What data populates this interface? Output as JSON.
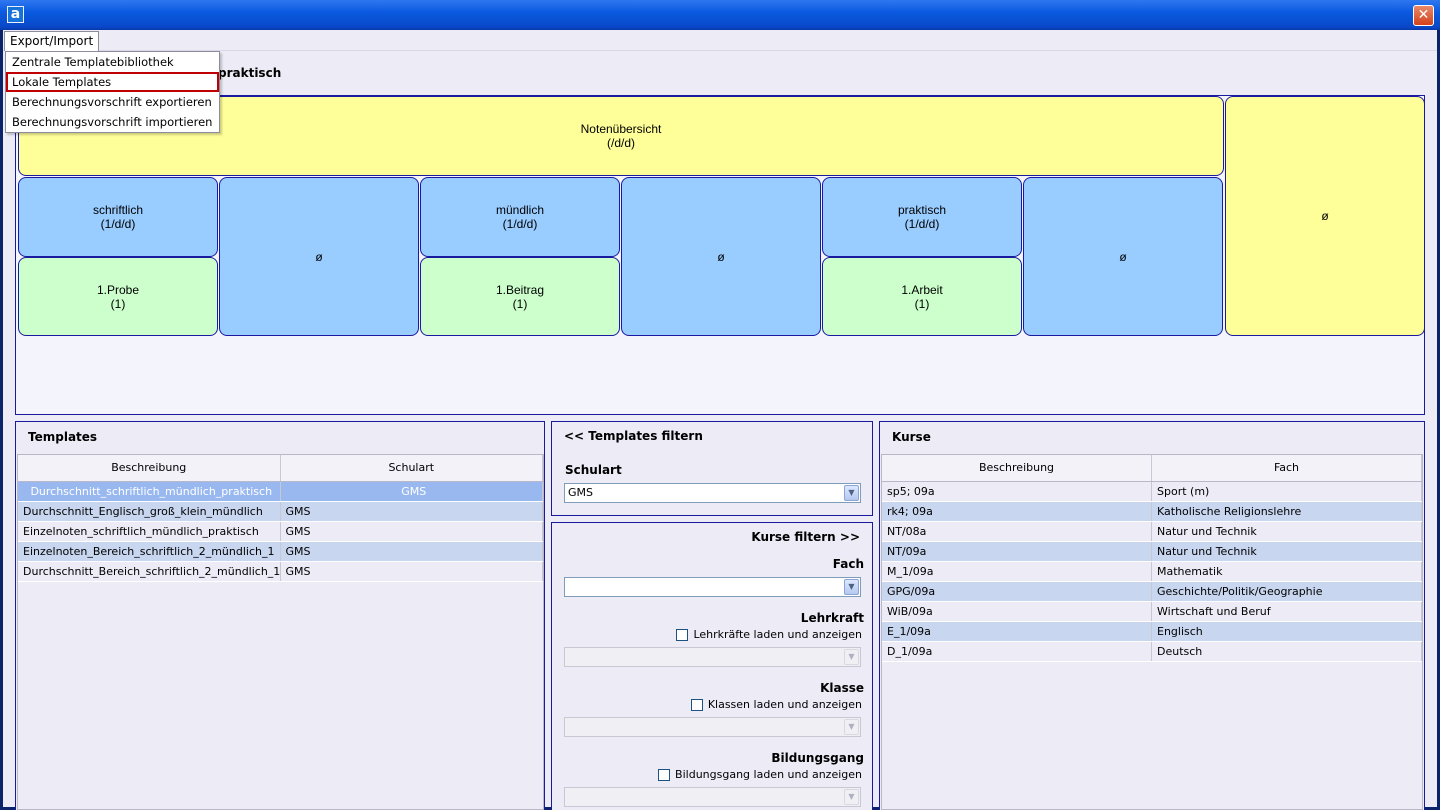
{
  "window": {
    "app_icon": "a",
    "close_glyph": "✕"
  },
  "menu": {
    "top_label": "Export/Import",
    "items": [
      "Zentrale Templatebibliothek",
      "Lokale Templates",
      "Berechnungsvorschrift exportieren",
      "Berechnungsvorschrift importieren"
    ],
    "selected_index": 1
  },
  "tree": {
    "header_label": "praktisch",
    "root": {
      "name": "Notenübersicht",
      "weight": "(/d/d)"
    },
    "root_avg": "ø",
    "groups": [
      {
        "name": "schriftlich",
        "weight": "(1/d/d)",
        "child_name": "1.Probe",
        "child_weight": "(1)",
        "avg": "ø"
      },
      {
        "name": "mündlich",
        "weight": "(1/d/d)",
        "child_name": "1.Beitrag",
        "child_weight": "(1)",
        "avg": "ø"
      },
      {
        "name": "praktisch",
        "weight": "(1/d/d)",
        "child_name": "1.Arbeit",
        "child_weight": "(1)",
        "avg": "ø"
      }
    ]
  },
  "templates": {
    "title": "Templates",
    "columns": [
      "Beschreibung",
      "Schulart"
    ],
    "rows": [
      [
        "Durchschnitt_schriftlich_mündlich_praktisch",
        "GMS"
      ],
      [
        "Durchschnitt_Englisch_groß_klein_mündlich",
        "GMS"
      ],
      [
        "Einzelnoten_schriftlich_mündlich_praktisch",
        "GMS"
      ],
      [
        "Einzelnoten_Bereich_schriftlich_2_mündlich_1",
        "GMS"
      ],
      [
        "Durchschnitt_Bereich_schriftlich_2_mündlich_1",
        "GMS"
      ]
    ]
  },
  "filter": {
    "templates_title": "<< Templates filtern",
    "schulart_label": "Schulart",
    "schulart_value": "GMS",
    "kurse_title": "Kurse filtern >>",
    "fach_label": "Fach",
    "fach_value": "",
    "lehrkraft_label": "Lehrkraft",
    "lehrkraft_checkbox": "Lehrkräfte laden und anzeigen",
    "klasse_label": "Klasse",
    "klasse_checkbox": "Klassen laden und anzeigen",
    "bildungsgang_label": "Bildungsgang",
    "bildungsgang_checkbox": "Bildungsgang laden und anzeigen"
  },
  "kurse": {
    "title": "Kurse",
    "columns": [
      "Beschreibung",
      "Fach"
    ],
    "rows": [
      [
        "sp5; 09a",
        "Sport (m)"
      ],
      [
        "rk4; 09a",
        "Katholische Religionslehre"
      ],
      [
        "NT/08a",
        "Natur und Technik"
      ],
      [
        "NT/09a",
        "Natur und Technik"
      ],
      [
        "M_1/09a",
        "Mathematik"
      ],
      [
        "GPG/09a",
        "Geschichte/Politik/Geographie"
      ],
      [
        "WiB/09a",
        "Wirtschaft und Beruf"
      ],
      [
        "E_1/09a",
        "Englisch"
      ],
      [
        "D_1/09a",
        "Deutsch"
      ]
    ]
  },
  "colors": {
    "node_yellow": "#ffff99",
    "node_blue": "#99ccff",
    "node_green": "#ccffcc",
    "selection_border": "#c00000"
  }
}
